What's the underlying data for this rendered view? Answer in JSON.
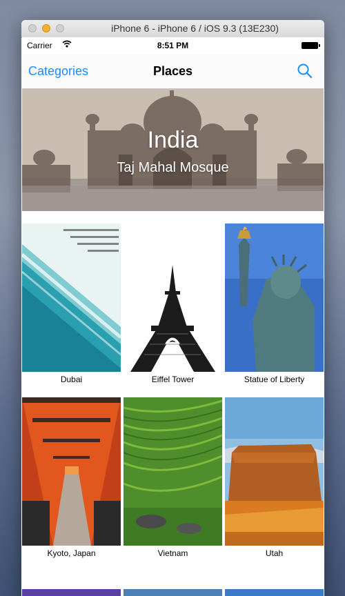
{
  "window": {
    "title": "iPhone 6 - iPhone 6 / iOS 9.3 (13E230)"
  },
  "status_bar": {
    "carrier": "Carrier",
    "time": "8:51 PM"
  },
  "nav": {
    "back_label": "Categories",
    "title": "Places",
    "search_icon": "search-icon"
  },
  "featured": {
    "title": "India",
    "subtitle": "Taj Mahal Mosque"
  },
  "places": [
    {
      "name": "Dubai"
    },
    {
      "name": "Eiffel Tower"
    },
    {
      "name": "Statue of Liberty"
    },
    {
      "name": "Kyoto, Japan"
    },
    {
      "name": "Vietnam"
    },
    {
      "name": "Utah"
    }
  ],
  "colors": {
    "accent": "#1a8cff",
    "minimize": "#f5b02c"
  }
}
